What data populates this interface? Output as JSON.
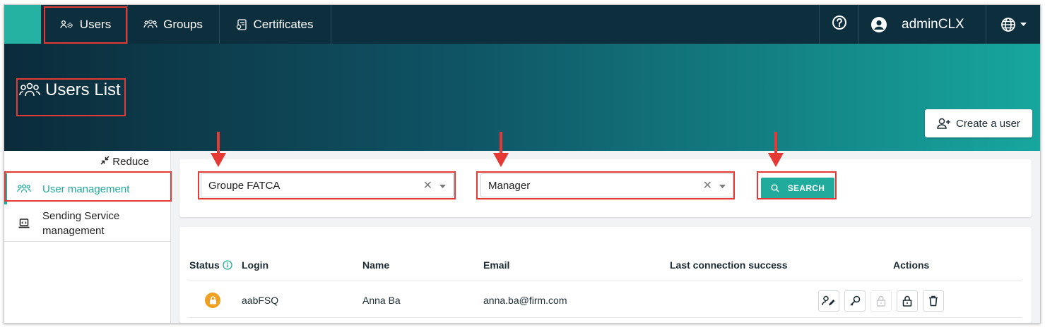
{
  "topbar": {
    "tabs": [
      {
        "label": "Users",
        "icon": "users-cog-icon"
      },
      {
        "label": "Groups",
        "icon": "group-icon"
      },
      {
        "label": "Certificates",
        "icon": "certificate-icon"
      }
    ],
    "help_icon": "help-circle-icon",
    "account_icon": "account-circle-icon",
    "username": "adminCLX",
    "language_icon": "globe-icon"
  },
  "header": {
    "title": "Users List",
    "create_label": "Create a user"
  },
  "sidebar": {
    "reduce_label": "Reduce",
    "items": [
      {
        "label": "User management",
        "icon": "users-icon",
        "active": true
      },
      {
        "label": "Sending Service management",
        "icon": "laptop-icon",
        "active": false
      }
    ]
  },
  "filters": {
    "group_value": "Groupe FATCA",
    "role_value": "Manager",
    "search_label": "SEARCH"
  },
  "table": {
    "columns": [
      "Status",
      "Login",
      "Name",
      "Email",
      "Last connection success",
      "Actions"
    ],
    "rows": [
      {
        "status": "locked",
        "login": "aabFSQ",
        "name": "Anna Ba",
        "email": "anna.ba@firm.com",
        "last_connection": ""
      }
    ]
  },
  "colors": {
    "topbar": "#0d2f3d",
    "accent": "#20ab9d",
    "annotation": "#e53935",
    "locked_status": "#f0a020"
  }
}
